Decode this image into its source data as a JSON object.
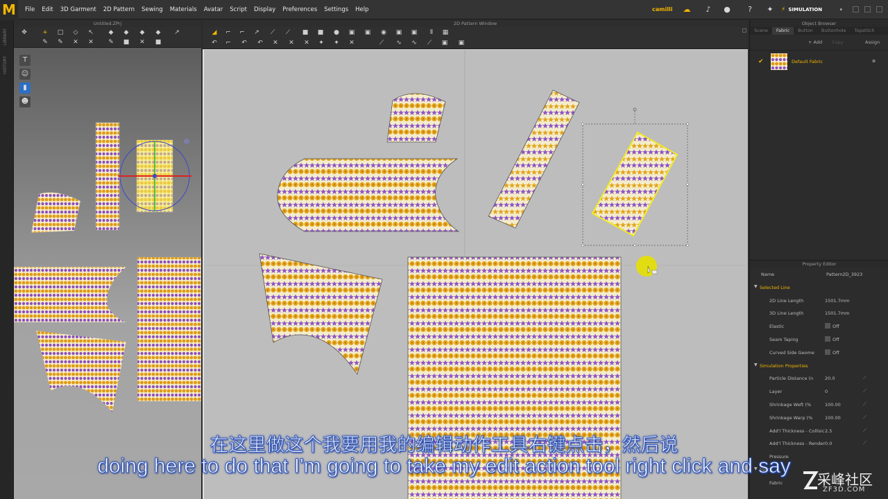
{
  "app": {
    "logo": "M",
    "menus": [
      "File",
      "Edit",
      "3D Garment",
      "2D Pattern",
      "Sewing",
      "Materials",
      "Avatar",
      "Script",
      "Display",
      "Preferences",
      "Settings",
      "Help"
    ],
    "user": "camilli",
    "mode": "SIMULATION",
    "accent": "#f2b600"
  },
  "left_strip": {
    "labels": [
      "LIBRARY",
      "HISTORY"
    ]
  },
  "window3d": {
    "title": "Untitled.ZPrj"
  },
  "window2d": {
    "title": "2D Pattern Window"
  },
  "object_browser": {
    "title": "Object Browser",
    "tabs": [
      "Scene",
      "Fabric",
      "Button",
      "Buttonhole",
      "Topstitch"
    ],
    "active_tab": "Fabric",
    "add_label": "+ Add",
    "copy_label": "Copy",
    "assign_label": "Assign",
    "fabric_name": "Default Fabric"
  },
  "property_editor": {
    "title": "Property Editor",
    "name_key": "Name",
    "name_value": "Pattern2D_3923",
    "sections": [
      {
        "title": "Selected Line",
        "rows": [
          {
            "k": "2D Line Length",
            "v": "1501.7mm",
            "type": "text"
          },
          {
            "k": "3D Line Length",
            "v": "1501.7mm",
            "type": "text"
          },
          {
            "k": "Elastic",
            "v": "Off",
            "type": "check"
          },
          {
            "k": "Seam Taping",
            "v": "Off",
            "type": "check"
          },
          {
            "k": "Curved Side Geome",
            "v": "Off",
            "type": "check"
          }
        ]
      },
      {
        "title": "Simulation Properties",
        "rows": [
          {
            "k": "Particle Distance (n",
            "v": "20.0",
            "type": "text"
          },
          {
            "k": "Layer",
            "v": "0",
            "type": "text"
          },
          {
            "k": "Shrinkage Weft (%",
            "v": "100.00",
            "type": "text"
          },
          {
            "k": "Shrinkage Warp (%",
            "v": "100.00",
            "type": "text"
          },
          {
            "k": "Add'l Thickness - Collisic",
            "v": "2.5",
            "type": "text"
          },
          {
            "k": "Add'l Thickness - Render",
            "v": "0.0",
            "type": "text"
          },
          {
            "k": "Pressure",
            "v": "",
            "type": "text"
          }
        ]
      },
      {
        "title": "Fabric",
        "rows": [
          {
            "k": "Fabric",
            "v": "",
            "type": "text"
          }
        ]
      }
    ]
  },
  "subtitles": {
    "cn": "在这里做这个我要用我的编辑动作工具右键点击，然后说",
    "en": "doing here to do that I'm going to take my edit action tool right click and say"
  },
  "watermark": {
    "main": "采峰社区",
    "sub": "ZF3D.COM"
  }
}
